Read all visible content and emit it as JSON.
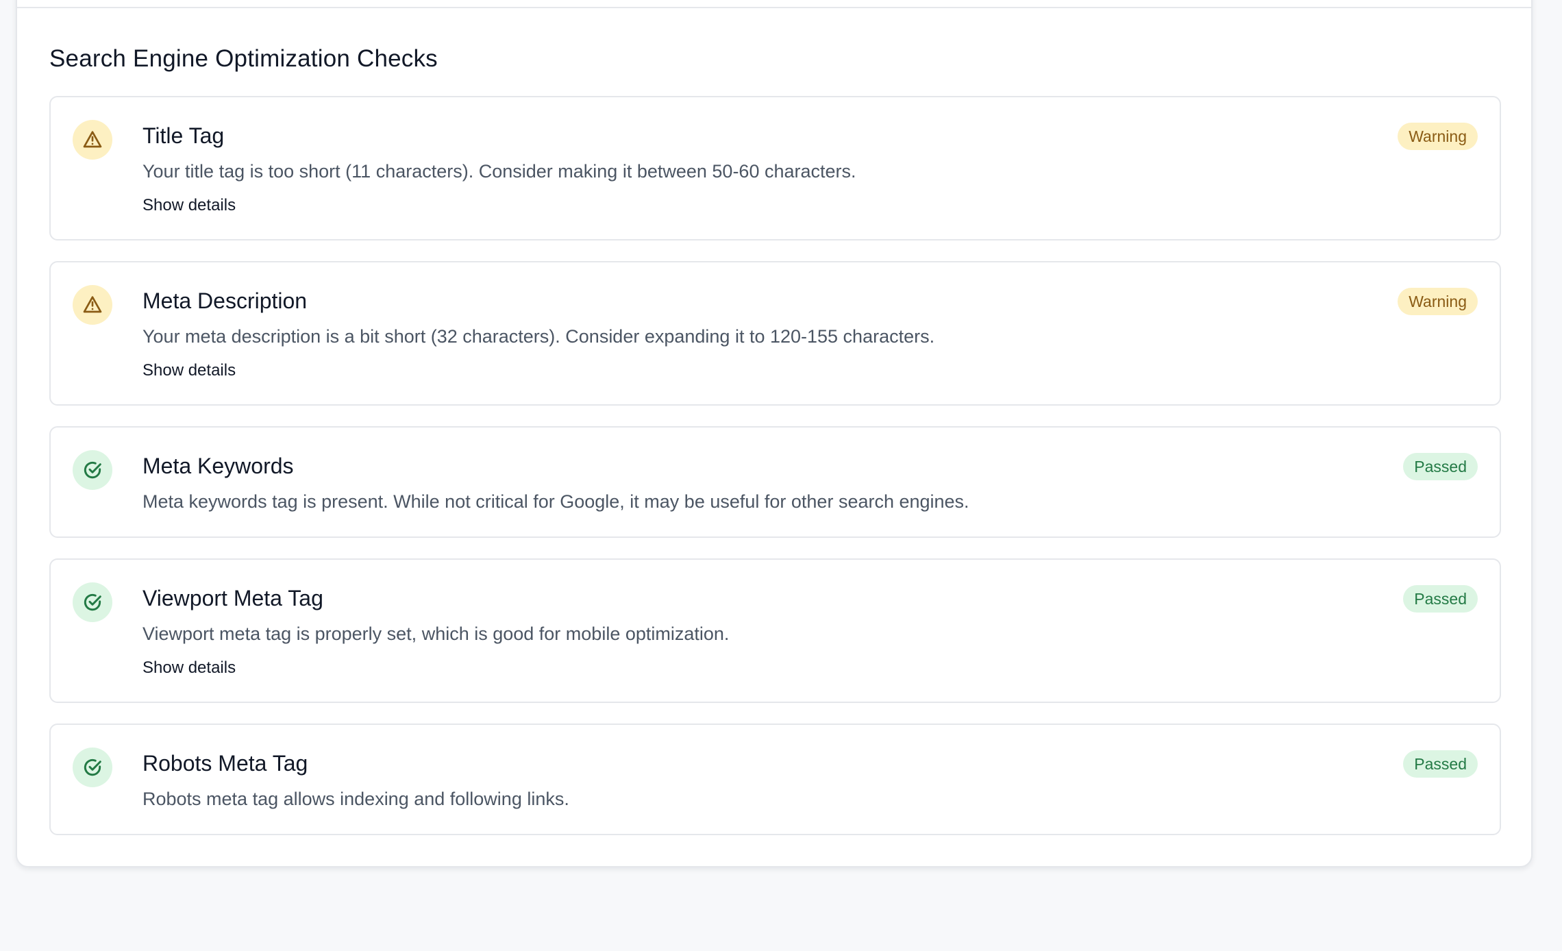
{
  "section": {
    "title": "Search Engine Optimization Checks"
  },
  "checks": [
    {
      "title": "Title Tag",
      "description": "Your title tag is too short (11 characters). Consider making it between 50-60 characters.",
      "status": "Warning",
      "status_icon": "warning-triangle-icon",
      "details_link": "Show details"
    },
    {
      "title": "Meta Description",
      "description": "Your meta description is a bit short (32 characters). Consider expanding it to 120-155 characters.",
      "status": "Warning",
      "status_icon": "warning-triangle-icon",
      "details_link": "Show details"
    },
    {
      "title": "Meta Keywords",
      "description": "Meta keywords tag is present. While not critical for Google, it may be useful for other search engines.",
      "status": "Passed",
      "status_icon": "check-circle-icon"
    },
    {
      "title": "Viewport Meta Tag",
      "description": "Viewport meta tag is properly set, which is good for mobile optimization.",
      "status": "Passed",
      "status_icon": "check-circle-icon",
      "details_link": "Show details"
    },
    {
      "title": "Robots Meta Tag",
      "description": "Robots meta tag allows indexing and following links.",
      "status": "Passed",
      "status_icon": "check-circle-icon"
    }
  ],
  "colors": {
    "warning_background": "#fdf0c2",
    "warning_text": "#8a5b14",
    "warning_icon": "#8a5b14",
    "passed_background": "#dcf5e3",
    "passed_text": "#237a45",
    "passed_icon": "#237a45",
    "card_border": "#e5e7eb",
    "page_background": "#f7f8fa"
  }
}
